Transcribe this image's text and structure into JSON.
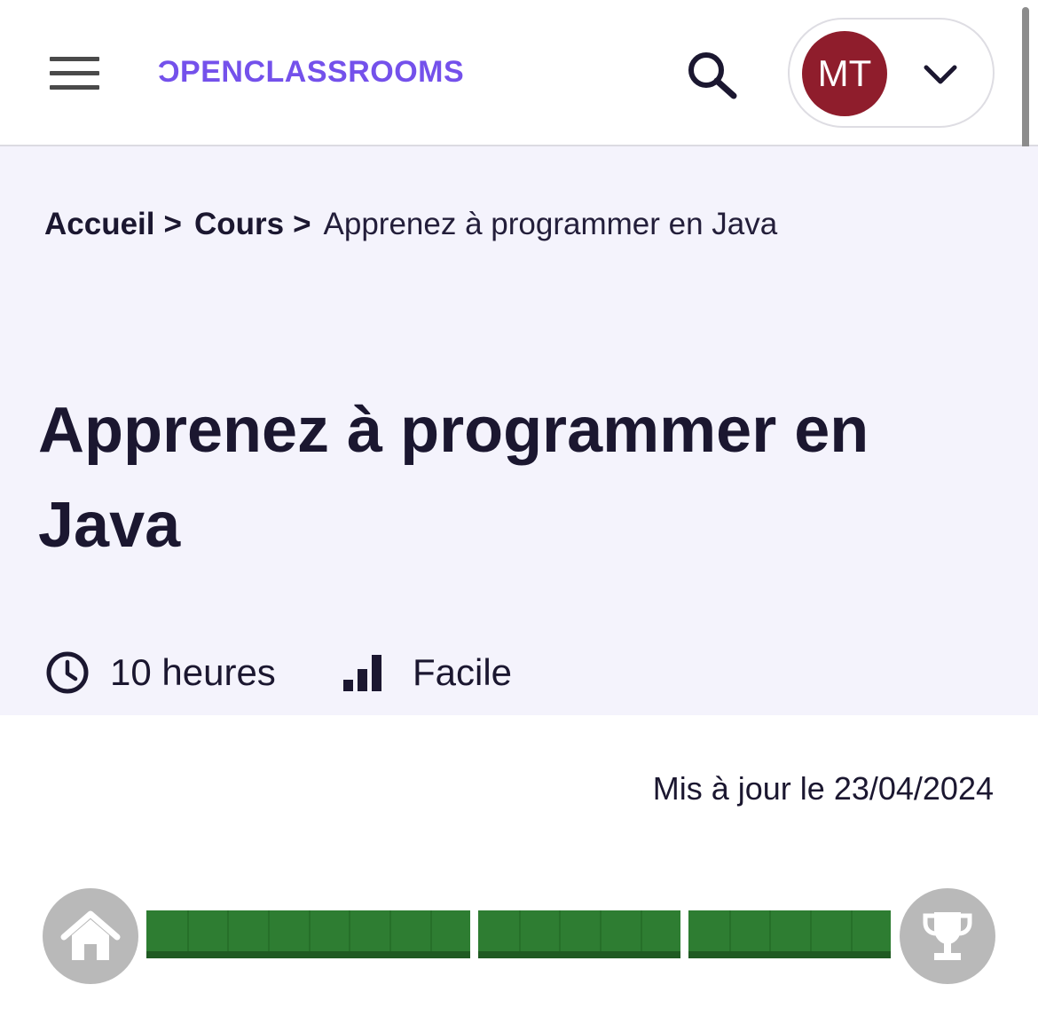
{
  "header": {
    "logo_text": "ƆPENCLASSROOMS",
    "menu_icon": "hamburger-menu-icon",
    "search_icon": "search-icon",
    "user_initials": "MT",
    "user_menu_icon": "chevron-down-icon",
    "avatar_color": "#8f1d2c",
    "brand_color": "#7451eb"
  },
  "breadcrumb": {
    "items": [
      "Accueil",
      "Cours"
    ],
    "separator": ">",
    "current": "Apprenez à programmer en Java"
  },
  "course": {
    "title": "Apprenez à programmer en Java",
    "duration": "10 heures",
    "duration_icon": "clock-icon",
    "level": "Facile",
    "level_icon": "difficulty-bars-icon",
    "updated": "Mis à jour le 23/04/2024"
  },
  "progress": {
    "start_icon": "home-icon",
    "end_icon": "trophy-icon",
    "completed_fraction": 1.0,
    "parts": [
      {
        "steps": 8,
        "completed": 8
      },
      {
        "steps": 5,
        "completed": 5
      },
      {
        "steps": 5,
        "completed": 5
      }
    ],
    "completed_color": "#2e7d32"
  }
}
